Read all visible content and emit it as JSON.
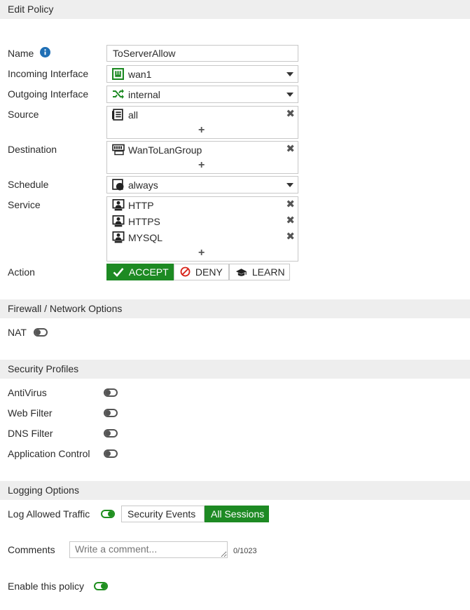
{
  "header": {
    "title": "Edit Policy"
  },
  "form": {
    "name_label": "Name",
    "name_value": "ToServerAllow",
    "incoming_label": "Incoming Interface",
    "incoming_value": "wan1",
    "outgoing_label": "Outgoing Interface",
    "outgoing_value": "internal",
    "source_label": "Source",
    "source_items": [
      "all"
    ],
    "destination_label": "Destination",
    "destination_items": [
      "WanToLanGroup"
    ],
    "schedule_label": "Schedule",
    "schedule_value": "always",
    "service_label": "Service",
    "service_items": [
      "HTTP",
      "HTTPS",
      "MYSQL"
    ],
    "add_symbol": "+",
    "remove_symbol": "✖",
    "action_label": "Action",
    "actions": [
      "ACCEPT",
      "DENY",
      "LEARN"
    ],
    "selected_action": "ACCEPT"
  },
  "firewall": {
    "title": "Firewall / Network Options",
    "nat_label": "NAT",
    "nat_enabled": false
  },
  "security": {
    "title": "Security Profiles",
    "items": [
      {
        "label": "AntiVirus",
        "enabled": false
      },
      {
        "label": "Web Filter",
        "enabled": false
      },
      {
        "label": "DNS Filter",
        "enabled": false
      },
      {
        "label": "Application Control",
        "enabled": false
      }
    ]
  },
  "logging": {
    "title": "Logging Options",
    "log_label": "Log Allowed Traffic",
    "log_enabled": true,
    "options": [
      "Security Events",
      "All Sessions"
    ],
    "selected_option": "All Sessions"
  },
  "comments": {
    "label": "Comments",
    "placeholder": "Write a comment...",
    "value": "",
    "counter": "0/1023"
  },
  "enable": {
    "label": "Enable this policy",
    "enabled": true
  },
  "colors": {
    "accent_green": "#1d8a23",
    "info_blue": "#1f6fb5",
    "header_bg": "#eeeeee"
  }
}
